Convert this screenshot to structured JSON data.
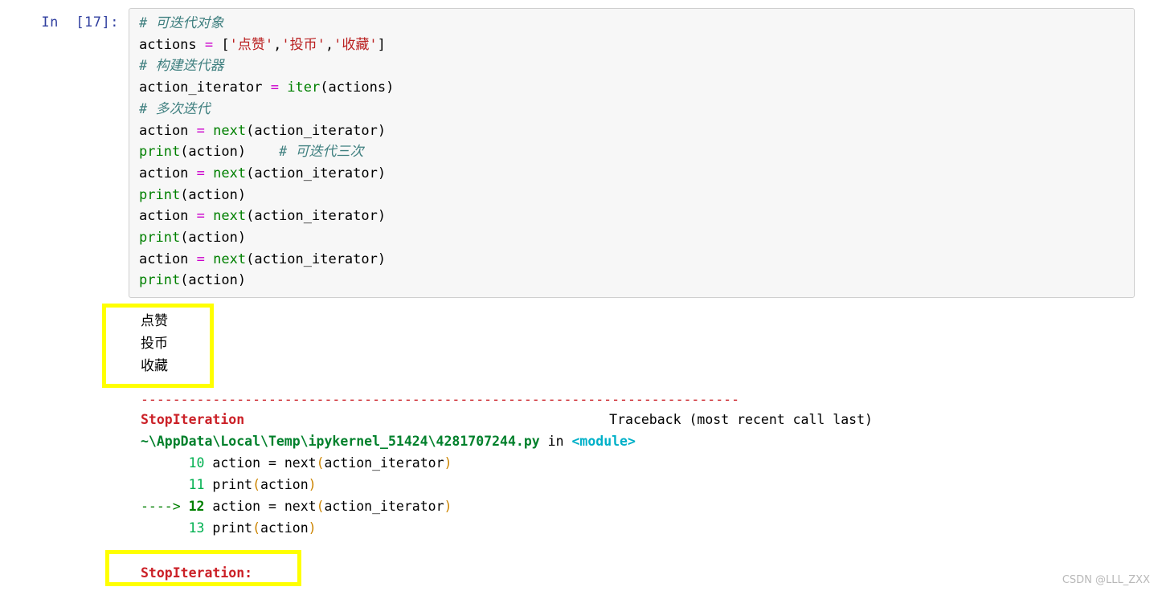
{
  "notebook": {
    "prompt_label": "In  [17]:",
    "code_lines": [
      [
        {
          "t": "comment",
          "s": "# 可迭代对象"
        }
      ],
      [
        {
          "t": "plain",
          "s": "actions "
        },
        {
          "t": "op",
          "s": "="
        },
        {
          "t": "plain",
          "s": " ["
        },
        {
          "t": "str",
          "s": "'点赞'"
        },
        {
          "t": "plain",
          "s": ","
        },
        {
          "t": "str",
          "s": "'投币'"
        },
        {
          "t": "plain",
          "s": ","
        },
        {
          "t": "str",
          "s": "'收藏'"
        },
        {
          "t": "plain",
          "s": "]"
        }
      ],
      [
        {
          "t": "comment",
          "s": "# 构建迭代器"
        }
      ],
      [
        {
          "t": "plain",
          "s": "action_iterator "
        },
        {
          "t": "op",
          "s": "="
        },
        {
          "t": "plain",
          "s": " "
        },
        {
          "t": "builtin",
          "s": "iter"
        },
        {
          "t": "plain",
          "s": "(actions)"
        }
      ],
      [
        {
          "t": "comment",
          "s": "# 多次迭代"
        }
      ],
      [
        {
          "t": "plain",
          "s": "action "
        },
        {
          "t": "op",
          "s": "="
        },
        {
          "t": "plain",
          "s": " "
        },
        {
          "t": "builtin",
          "s": "next"
        },
        {
          "t": "plain",
          "s": "(action_iterator)"
        }
      ],
      [
        {
          "t": "builtin",
          "s": "print"
        },
        {
          "t": "plain",
          "s": "(action)    "
        },
        {
          "t": "comment",
          "s": "# 可迭代三次"
        }
      ],
      [
        {
          "t": "plain",
          "s": "action "
        },
        {
          "t": "op",
          "s": "="
        },
        {
          "t": "plain",
          "s": " "
        },
        {
          "t": "builtin",
          "s": "next"
        },
        {
          "t": "plain",
          "s": "(action_iterator)"
        }
      ],
      [
        {
          "t": "builtin",
          "s": "print"
        },
        {
          "t": "plain",
          "s": "(action)"
        }
      ],
      [
        {
          "t": "plain",
          "s": "action "
        },
        {
          "t": "op",
          "s": "="
        },
        {
          "t": "plain",
          "s": " "
        },
        {
          "t": "builtin",
          "s": "next"
        },
        {
          "t": "plain",
          "s": "(action_iterator)"
        }
      ],
      [
        {
          "t": "builtin",
          "s": "print"
        },
        {
          "t": "plain",
          "s": "(action)"
        }
      ],
      [
        {
          "t": "plain",
          "s": "action "
        },
        {
          "t": "op",
          "s": "="
        },
        {
          "t": "plain",
          "s": " "
        },
        {
          "t": "builtin",
          "s": "next"
        },
        {
          "t": "plain",
          "s": "(action_iterator)"
        }
      ],
      [
        {
          "t": "builtin",
          "s": "print"
        },
        {
          "t": "plain",
          "s": "(action)"
        }
      ]
    ]
  },
  "stdout": {
    "lines": [
      "点赞",
      "投币",
      "收藏"
    ]
  },
  "traceback": {
    "rule": "---------------------------------------------------------------------------",
    "exception_name": "StopIteration",
    "header_text": "Traceback (most recent call last)",
    "file_path": "~\\AppData\\Local\\Temp\\ipykernel_51424\\4281707244.py",
    "in_word": " in ",
    "scope": "<module>",
    "frames": [
      {
        "arrow": "     ",
        "lineno": "10",
        "segments": [
          {
            "t": "txt",
            "s": " action = next"
          },
          {
            "t": "paren",
            "s": "("
          },
          {
            "t": "txt",
            "s": "action_iterator"
          },
          {
            "t": "paren",
            "s": ")"
          }
        ],
        "current": false
      },
      {
        "arrow": "     ",
        "lineno": "11",
        "segments": [
          {
            "t": "txt",
            "s": " print"
          },
          {
            "t": "paren",
            "s": "("
          },
          {
            "t": "txt",
            "s": "action"
          },
          {
            "t": "paren",
            "s": ")"
          }
        ],
        "current": false
      },
      {
        "arrow": "---->",
        "lineno": "12",
        "segments": [
          {
            "t": "txt",
            "s": " action = next"
          },
          {
            "t": "paren",
            "s": "("
          },
          {
            "t": "txt",
            "s": "action_iterator"
          },
          {
            "t": "paren",
            "s": ")"
          }
        ],
        "current": true
      },
      {
        "arrow": "     ",
        "lineno": "13",
        "segments": [
          {
            "t": "txt",
            "s": " print"
          },
          {
            "t": "paren",
            "s": "("
          },
          {
            "t": "txt",
            "s": "action"
          },
          {
            "t": "paren",
            "s": ")"
          }
        ],
        "current": false
      }
    ],
    "final_message": "StopIteration:"
  },
  "watermark": {
    "text": "CSDN @LLL_ZXX"
  },
  "colors": {
    "comment": "#408080",
    "string": "#ba2121",
    "operator": "#cc00cc",
    "builtin": "#008000",
    "exception": "#cb2027",
    "path": "#00802b",
    "module": "#00b0c8",
    "lineno": "#00b050",
    "paren": "#cc8400",
    "prompt": "#303f9f",
    "highlight_border": "#ffff00",
    "cell_bg": "#f7f7f7",
    "cell_border": "#cfcfcf",
    "watermark": "#b8b8b8"
  }
}
